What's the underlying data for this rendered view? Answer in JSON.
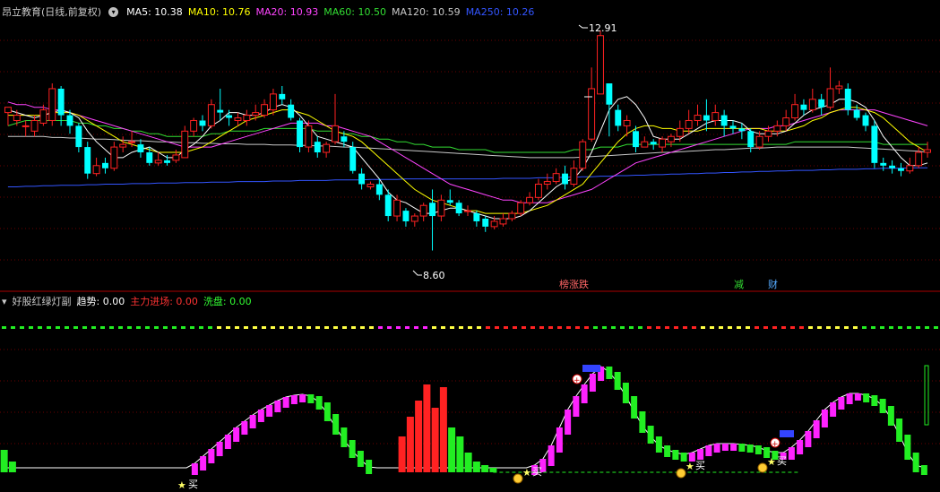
{
  "header": {
    "stock_title": "昂立教育(日线,前复权)",
    "ma": [
      {
        "label": "MA5: 10.38",
        "color": "#ffffff"
      },
      {
        "label": "MA10: 10.76",
        "color": "#ffff00"
      },
      {
        "label": "MA20: 10.93",
        "color": "#ff44ff"
      },
      {
        "label": "MA60: 10.50",
        "color": "#33dd33"
      },
      {
        "label": "MA120: 10.59",
        "color": "#c8c8c8"
      },
      {
        "label": "MA250: 10.26",
        "color": "#3355ff"
      }
    ]
  },
  "price_panel": {
    "high_label": "12.91",
    "low_label": "8.60",
    "signals": [
      {
        "text": "榜涨跌",
        "color": "#ff6666"
      },
      {
        "text": "减",
        "color": "#33dd33"
      },
      {
        "text": "财",
        "color": "#55aaff"
      }
    ]
  },
  "indicator": {
    "name": "好股红绿灯副",
    "trend_label": "趋势: 0.00",
    "main_force_label": "主力进场: 0.00",
    "wash_label": "洗盘: 0.00",
    "buy_label": "买",
    "colors": {
      "up": "#ff2222",
      "down": "#00ffff",
      "pink": "#ff22ff",
      "green": "#22ee22"
    }
  },
  "chart_data": {
    "type": "candlestick",
    "ylim": [
      8.2,
      13.2
    ],
    "candles": [
      [
        11.45,
        11.55,
        11.5,
        11.2
      ],
      [
        11.3,
        11.4,
        11.5,
        11.2
      ],
      [
        11.2,
        11.2,
        11.3,
        11.0
      ],
      [
        11.1,
        11.3,
        11.4,
        11.0
      ],
      [
        11.25,
        11.5,
        11.6,
        11.2
      ],
      [
        11.3,
        11.9,
        12.0,
        11.2
      ],
      [
        11.9,
        11.4,
        11.95,
        11.2
      ],
      [
        11.4,
        11.2,
        11.5,
        11.05
      ],
      [
        11.2,
        10.8,
        11.25,
        10.7
      ],
      [
        10.8,
        10.3,
        10.9,
        10.2
      ],
      [
        10.3,
        10.45,
        10.6,
        10.25
      ],
      [
        10.5,
        10.4,
        10.6,
        10.3
      ],
      [
        10.4,
        10.8,
        10.9,
        10.35
      ],
      [
        10.8,
        10.85,
        11.0,
        10.7
      ],
      [
        10.9,
        10.9,
        11.1,
        10.8
      ],
      [
        10.85,
        10.7,
        10.95,
        10.6
      ],
      [
        10.7,
        10.5,
        10.8,
        10.45
      ],
      [
        10.5,
        10.55,
        10.7,
        10.45
      ],
      [
        10.55,
        10.5,
        10.65,
        10.45
      ],
      [
        10.55,
        10.65,
        10.75,
        10.5
      ],
      [
        10.6,
        11.1,
        11.2,
        10.6
      ],
      [
        11.1,
        11.3,
        11.35,
        11.0
      ],
      [
        11.3,
        11.2,
        11.4,
        11.1
      ],
      [
        11.2,
        11.6,
        11.7,
        11.15
      ],
      [
        11.5,
        11.45,
        11.9,
        11.3
      ],
      [
        11.4,
        11.35,
        11.5,
        11.2
      ],
      [
        11.3,
        11.35,
        11.45,
        11.2
      ],
      [
        11.3,
        11.4,
        11.5,
        11.2
      ],
      [
        11.4,
        11.45,
        11.6,
        11.3
      ],
      [
        11.4,
        11.6,
        11.7,
        11.35
      ],
      [
        11.5,
        11.8,
        11.9,
        11.4
      ],
      [
        11.8,
        11.7,
        11.95,
        11.6
      ],
      [
        11.6,
        11.35,
        11.7,
        11.3
      ],
      [
        11.3,
        10.8,
        11.35,
        10.7
      ],
      [
        10.8,
        11.2,
        11.3,
        10.7
      ],
      [
        10.9,
        10.7,
        11.0,
        10.6
      ],
      [
        10.7,
        10.85,
        10.9,
        10.6
      ],
      [
        10.9,
        11.2,
        11.8,
        10.85
      ],
      [
        11.0,
        10.9,
        11.1,
        10.8
      ],
      [
        10.8,
        10.35,
        10.9,
        10.3
      ],
      [
        10.3,
        10.1,
        10.4,
        10.0
      ],
      [
        10.05,
        10.1,
        10.15,
        10.0
      ],
      [
        10.1,
        9.9,
        10.2,
        9.8
      ],
      [
        9.9,
        9.5,
        10.0,
        9.4
      ],
      [
        9.5,
        9.8,
        9.9,
        9.4
      ],
      [
        9.6,
        9.4,
        9.65,
        9.3
      ],
      [
        9.4,
        9.5,
        9.55,
        9.3
      ],
      [
        9.5,
        9.7,
        9.75,
        9.4
      ],
      [
        9.75,
        9.5,
        10.0,
        8.85
      ],
      [
        9.5,
        9.8,
        9.9,
        9.4
      ],
      [
        9.8,
        9.75,
        10.0,
        9.7
      ],
      [
        9.75,
        9.55,
        9.8,
        9.5
      ],
      [
        9.6,
        9.6,
        9.7,
        9.5
      ],
      [
        9.55,
        9.4,
        9.6,
        9.3
      ],
      [
        9.45,
        9.3,
        9.5,
        9.2
      ],
      [
        9.3,
        9.4,
        9.5,
        9.25
      ],
      [
        9.35,
        9.45,
        9.55,
        9.3
      ],
      [
        9.45,
        9.55,
        9.6,
        9.4
      ],
      [
        9.55,
        9.75,
        9.8,
        9.5
      ],
      [
        9.75,
        9.85,
        9.95,
        9.7
      ],
      [
        9.85,
        10.1,
        10.2,
        9.8
      ],
      [
        10.1,
        10.15,
        10.3,
        10.0
      ],
      [
        10.15,
        10.3,
        10.4,
        10.1
      ],
      [
        10.3,
        10.1,
        10.45,
        10.0
      ],
      [
        10.1,
        10.4,
        10.55,
        10.05
      ],
      [
        10.4,
        10.9,
        10.95,
        10.35
      ],
      [
        10.95,
        11.9,
        12.3,
        10.9
      ],
      [
        11.8,
        12.9,
        13.0,
        11.8
      ],
      [
        12.0,
        11.6,
        12.0,
        11.0
      ],
      [
        11.5,
        11.2,
        11.6,
        11.1
      ],
      [
        11.2,
        11.3,
        11.4,
        11.0
      ],
      [
        11.1,
        10.8,
        11.2,
        10.7
      ],
      [
        10.8,
        10.9,
        11.0,
        10.8
      ],
      [
        10.9,
        10.85,
        10.95,
        10.75
      ],
      [
        10.8,
        10.95,
        11.0,
        10.7
      ],
      [
        10.9,
        11.0,
        11.05,
        10.8
      ],
      [
        11.0,
        11.15,
        11.3,
        10.9
      ],
      [
        11.15,
        11.3,
        11.5,
        11.05
      ],
      [
        11.3,
        11.4,
        11.6,
        11.2
      ],
      [
        11.4,
        11.3,
        11.7,
        11.1
      ],
      [
        11.3,
        11.45,
        11.6,
        11.2
      ],
      [
        11.4,
        11.2,
        11.5,
        11.0
      ],
      [
        11.2,
        11.15,
        11.3,
        11.05
      ],
      [
        11.15,
        11.1,
        11.25,
        10.95
      ],
      [
        11.1,
        10.8,
        11.15,
        10.7
      ],
      [
        10.8,
        11.0,
        11.1,
        10.75
      ],
      [
        11.0,
        11.1,
        11.2,
        10.9
      ],
      [
        11.1,
        11.2,
        11.3,
        11.0
      ],
      [
        11.2,
        11.35,
        11.5,
        11.1
      ],
      [
        11.35,
        11.6,
        11.8,
        11.3
      ],
      [
        11.6,
        11.5,
        11.7,
        11.4
      ],
      [
        11.5,
        11.7,
        11.9,
        11.45
      ],
      [
        11.7,
        11.55,
        11.8,
        11.4
      ],
      [
        11.55,
        11.9,
        12.3,
        11.5
      ],
      [
        11.9,
        11.95,
        12.05,
        11.8
      ],
      [
        11.9,
        11.5,
        12.0,
        11.4
      ],
      [
        11.5,
        11.35,
        11.6,
        11.3
      ],
      [
        11.4,
        11.2,
        11.45,
        11.1
      ],
      [
        11.2,
        10.5,
        11.3,
        10.4
      ],
      [
        10.5,
        10.45,
        10.6,
        10.35
      ],
      [
        10.45,
        10.4,
        10.55,
        10.3
      ],
      [
        10.4,
        10.35,
        10.5,
        10.25
      ],
      [
        10.35,
        10.45,
        10.6,
        10.3
      ],
      [
        10.45,
        10.7,
        10.8,
        10.4
      ],
      [
        10.7,
        10.75,
        10.9,
        10.6
      ]
    ],
    "ma5": [
      11.5,
      11.45,
      11.4,
      11.35,
      11.4,
      11.45,
      11.5,
      11.45,
      11.35,
      11.1,
      10.9,
      10.75,
      10.6,
      10.6,
      10.7,
      10.75,
      10.8,
      10.7,
      10.6,
      10.6,
      10.75,
      10.85,
      11.0,
      11.2,
      11.3,
      11.45,
      11.45,
      11.4,
      11.4,
      11.45,
      11.55,
      11.6,
      11.55,
      11.4,
      11.2,
      11.0,
      10.95,
      10.9,
      10.85,
      10.8,
      10.6,
      10.4,
      10.2,
      9.95,
      9.8,
      9.75,
      9.65,
      9.55,
      9.55,
      9.6,
      9.65,
      9.65,
      9.6,
      9.55,
      9.5,
      9.45,
      9.45,
      9.45,
      9.5,
      9.6,
      9.75,
      9.9,
      10.05,
      10.15,
      10.2,
      10.4,
      10.7,
      11.1,
      11.5,
      11.7,
      11.75,
      11.6,
      11.35,
      11.0,
      10.95,
      10.95,
      10.95,
      11.05,
      11.15,
      11.25,
      11.3,
      11.3,
      11.3,
      11.25,
      11.1,
      11.05,
      11.05,
      11.05,
      11.1,
      11.25,
      11.4,
      11.5,
      11.55,
      11.6,
      11.7,
      11.7,
      11.65,
      11.55,
      11.3,
      11.0,
      10.8,
      10.6,
      10.45,
      10.45,
      10.5
    ],
    "ma10": [
      11.4,
      11.4,
      11.4,
      11.4,
      11.4,
      11.45,
      11.45,
      11.45,
      11.4,
      11.3,
      11.2,
      11.1,
      11.0,
      10.9,
      10.85,
      10.8,
      10.75,
      10.7,
      10.7,
      10.7,
      10.7,
      10.75,
      10.8,
      10.9,
      11.0,
      11.1,
      11.2,
      11.3,
      11.35,
      11.4,
      11.45,
      11.5,
      11.5,
      11.45,
      11.4,
      11.3,
      11.2,
      11.1,
      11.05,
      11.0,
      10.9,
      10.75,
      10.6,
      10.45,
      10.3,
      10.15,
      10.0,
      9.9,
      9.8,
      9.75,
      9.7,
      9.65,
      9.6,
      9.6,
      9.55,
      9.55,
      9.55,
      9.55,
      9.55,
      9.6,
      9.65,
      9.7,
      9.8,
      9.9,
      10.0,
      10.1,
      10.3,
      10.5,
      10.7,
      10.9,
      11.05,
      11.15,
      11.2,
      11.2,
      11.15,
      11.15,
      11.1,
      11.1,
      11.1,
      11.15,
      11.15,
      11.15,
      11.15,
      11.15,
      11.15,
      11.15,
      11.1,
      11.1,
      11.1,
      11.15,
      11.2,
      11.3,
      11.35,
      11.45,
      11.5,
      11.55,
      11.55,
      11.5,
      11.45,
      11.35,
      11.2,
      11.05,
      10.9,
      10.8,
      10.7
    ],
    "ma20": [
      11.65,
      11.6,
      11.6,
      11.55,
      11.55,
      11.5,
      11.5,
      11.45,
      11.4,
      11.35,
      11.3,
      11.25,
      11.2,
      11.15,
      11.1,
      11.05,
      11.0,
      10.95,
      10.9,
      10.85,
      10.8,
      10.8,
      10.8,
      10.8,
      10.85,
      10.9,
      10.95,
      11.0,
      11.05,
      11.1,
      11.15,
      11.2,
      11.25,
      11.25,
      11.25,
      11.25,
      11.2,
      11.2,
      11.15,
      11.1,
      11.05,
      11.0,
      10.9,
      10.8,
      10.7,
      10.6,
      10.5,
      10.4,
      10.3,
      10.2,
      10.1,
      10.05,
      10.0,
      9.95,
      9.9,
      9.85,
      9.8,
      9.8,
      9.75,
      9.75,
      9.75,
      9.75,
      9.8,
      9.85,
      9.9,
      9.95,
      10.0,
      10.1,
      10.2,
      10.3,
      10.4,
      10.5,
      10.55,
      10.6,
      10.65,
      10.7,
      10.75,
      10.8,
      10.85,
      10.9,
      10.95,
      11.0,
      11.05,
      11.1,
      11.15,
      11.15,
      11.15,
      11.2,
      11.2,
      11.25,
      11.3,
      11.35,
      11.4,
      11.45,
      11.5,
      11.5,
      11.5,
      11.5,
      11.5,
      11.45,
      11.4,
      11.35,
      11.3,
      11.25,
      11.2
    ],
    "ma60": [
      11.2,
      11.25,
      11.3,
      11.3,
      11.3,
      11.3,
      11.3,
      11.3,
      11.25,
      11.25,
      11.2,
      11.2,
      11.15,
      11.15,
      11.1,
      11.1,
      11.05,
      11.05,
      11.0,
      11.0,
      11.0,
      11.0,
      11.0,
      11.05,
      11.05,
      11.1,
      11.1,
      11.1,
      11.1,
      11.15,
      11.15,
      11.15,
      11.15,
      11.15,
      11.15,
      11.1,
      11.1,
      11.1,
      11.05,
      11.05,
      11.0,
      11.0,
      10.95,
      10.95,
      10.9,
      10.9,
      10.85,
      10.85,
      10.8,
      10.8,
      10.8,
      10.75,
      10.75,
      10.75,
      10.75,
      10.7,
      10.7,
      10.7,
      10.7,
      10.7,
      10.7,
      10.7,
      10.7,
      10.7,
      10.75,
      10.75,
      10.75,
      10.8,
      10.8,
      10.8,
      10.85,
      10.85,
      10.85,
      10.85,
      10.85,
      10.85,
      10.85,
      10.85,
      10.85,
      10.85,
      10.85,
      10.85,
      10.85,
      10.85,
      10.85,
      10.85,
      10.85,
      10.85,
      10.85,
      10.9,
      10.9,
      10.9,
      10.9,
      10.9,
      10.9,
      10.9,
      10.9,
      10.9,
      10.9,
      10.85,
      10.85,
      10.85,
      10.85,
      10.85,
      10.85
    ],
    "ma120": [
      11.0,
      11.0,
      11.0,
      11.0,
      11.0,
      10.98,
      10.98,
      10.97,
      10.97,
      10.96,
      10.95,
      10.95,
      10.94,
      10.93,
      10.92,
      10.92,
      10.91,
      10.9,
      10.9,
      10.89,
      10.88,
      10.88,
      10.87,
      10.87,
      10.86,
      10.86,
      10.86,
      10.85,
      10.85,
      10.85,
      10.84,
      10.84,
      10.84,
      10.83,
      10.83,
      10.82,
      10.82,
      10.81,
      10.8,
      10.8,
      10.79,
      10.78,
      10.77,
      10.76,
      10.75,
      10.74,
      10.73,
      10.72,
      10.71,
      10.7,
      10.69,
      10.68,
      10.67,
      10.66,
      10.65,
      10.64,
      10.63,
      10.62,
      10.61,
      10.6,
      10.6,
      10.6,
      10.6,
      10.6,
      10.6,
      10.61,
      10.62,
      10.63,
      10.64,
      10.65,
      10.66,
      10.67,
      10.68,
      10.69,
      10.7,
      10.7,
      10.71,
      10.72,
      10.73,
      10.74,
      10.75,
      10.75,
      10.76,
      10.77,
      10.78,
      10.78,
      10.79,
      10.8,
      10.8,
      10.8,
      10.8,
      10.8,
      10.8,
      10.8,
      10.8,
      10.8,
      10.79,
      10.78,
      10.77,
      10.76,
      10.75,
      10.74,
      10.73,
      10.72,
      10.7
    ],
    "ma250": [
      10.05,
      10.05,
      10.06,
      10.06,
      10.07,
      10.07,
      10.08,
      10.08,
      10.08,
      10.09,
      10.09,
      10.1,
      10.1,
      10.1,
      10.11,
      10.11,
      10.11,
      10.12,
      10.12,
      10.12,
      10.13,
      10.13,
      10.13,
      10.14,
      10.14,
      10.14,
      10.15,
      10.15,
      10.15,
      10.15,
      10.16,
      10.16,
      10.16,
      10.17,
      10.17,
      10.17,
      10.17,
      10.18,
      10.18,
      10.18,
      10.18,
      10.19,
      10.19,
      10.19,
      10.19,
      10.2,
      10.2,
      10.2,
      10.2,
      10.2,
      10.2,
      10.2,
      10.2,
      10.2,
      10.2,
      10.2,
      10.21,
      10.21,
      10.21,
      10.21,
      10.22,
      10.22,
      10.22,
      10.23,
      10.23,
      10.24,
      10.24,
      10.25,
      10.25,
      10.26,
      10.26,
      10.27,
      10.27,
      10.28,
      10.28,
      10.29,
      10.29,
      10.3,
      10.3,
      10.31,
      10.31,
      10.32,
      10.32,
      10.33,
      10.33,
      10.34,
      10.34,
      10.35,
      10.35,
      10.36,
      10.36,
      10.36,
      10.37,
      10.37,
      10.38,
      10.38,
      10.38,
      10.39,
      10.39,
      10.4,
      10.4,
      10.4,
      10.41,
      10.41,
      10.41
    ]
  },
  "osc_data": {
    "curve": [
      5,
      5,
      5,
      5,
      5,
      5,
      5,
      5,
      5,
      5,
      5,
      5,
      5,
      5,
      5,
      5,
      5,
      5,
      5,
      5,
      5,
      5,
      5,
      10,
      18,
      26,
      34,
      42,
      50,
      57,
      64,
      70,
      75,
      80,
      84,
      86,
      87,
      85,
      78,
      65,
      50,
      36,
      24,
      14,
      6,
      5,
      5,
      5,
      5,
      5,
      5,
      5,
      5,
      5,
      5,
      5,
      5,
      5,
      5,
      5,
      5,
      5,
      5,
      5,
      8,
      15,
      30,
      50,
      70,
      85,
      98,
      110,
      118,
      112,
      100,
      85,
      68,
      52,
      40,
      30,
      25,
      22,
      20,
      22,
      26,
      30,
      32,
      32,
      32,
      31,
      30,
      28,
      24,
      22,
      22,
      28,
      36,
      46,
      58,
      70,
      78,
      84,
      88,
      88,
      86,
      82,
      74,
      60,
      42,
      22,
      8,
      5
    ],
    "bars": [
      25,
      12,
      0,
      0,
      0,
      0,
      0,
      0,
      0,
      0,
      0,
      0,
      0,
      0,
      0,
      0,
      0,
      0,
      0,
      0,
      0,
      0,
      0,
      0,
      0,
      0,
      0,
      0,
      0,
      0,
      0,
      0,
      0,
      0,
      0,
      0,
      0,
      0,
      0,
      0,
      0,
      0,
      0,
      0,
      0,
      0,
      0,
      0,
      0,
      0,
      0,
      0,
      0,
      0,
      0,
      0,
      0,
      0,
      0,
      0,
      0,
      0,
      0,
      0,
      0,
      0,
      0,
      0,
      0,
      0,
      0,
      0,
      0,
      0,
      0,
      0,
      0,
      0,
      0,
      0,
      0,
      0,
      0,
      0,
      0,
      0,
      0,
      0,
      0,
      0,
      0,
      0,
      0,
      0,
      0,
      0,
      0,
      0,
      0,
      0,
      0,
      0,
      0,
      0,
      0,
      0,
      0,
      0,
      0,
      0,
      0,
      0
    ],
    "red_bars": [
      [
        48,
        40
      ],
      [
        49,
        62
      ],
      [
        50,
        80
      ],
      [
        51,
        98
      ],
      [
        52,
        72
      ],
      [
        53,
        95
      ]
    ],
    "green_bars": [
      [
        54,
        50
      ],
      [
        55,
        40
      ],
      [
        56,
        22
      ],
      [
        57,
        12
      ],
      [
        58,
        8
      ],
      [
        59,
        5
      ]
    ]
  }
}
